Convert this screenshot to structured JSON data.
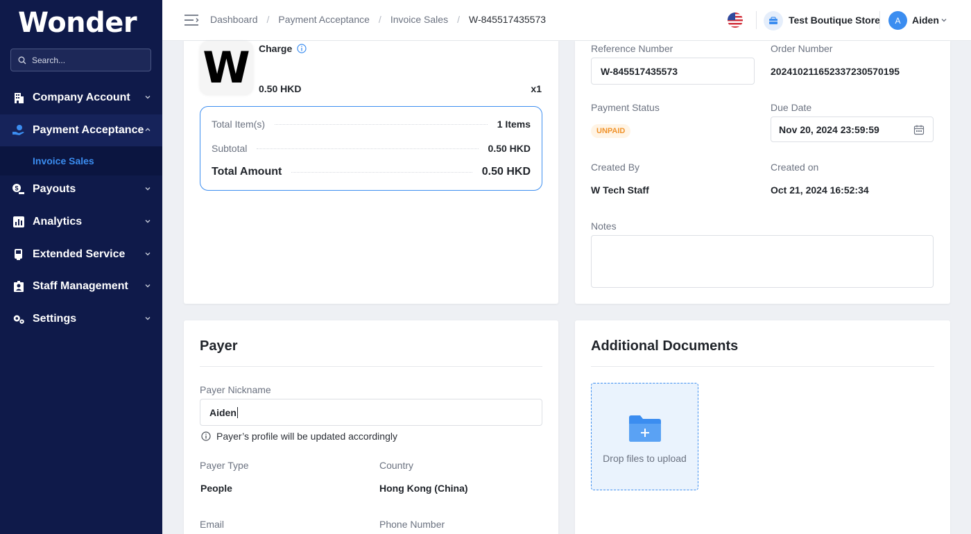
{
  "sidebar": {
    "brand": "Wonder",
    "search_placeholder": "Search...",
    "items": [
      {
        "label": "Company Account"
      },
      {
        "label": "Payment Acceptance"
      },
      {
        "label": "Payouts"
      },
      {
        "label": "Analytics"
      },
      {
        "label": "Extended Service"
      },
      {
        "label": "Staff Management"
      },
      {
        "label": "Settings"
      }
    ],
    "sub_item": "Invoice Sales"
  },
  "topbar": {
    "breadcrumbs": [
      "Dashboard",
      "Payment Acceptance",
      "Invoice Sales",
      "W-845517435573"
    ],
    "store": "Test Boutique Store",
    "avatar_initial": "A",
    "user": "Aiden"
  },
  "order": {
    "logo_letter": "W",
    "item_name": "Charge",
    "item_price": "0.50 HKD",
    "item_qty": "x1",
    "summary": {
      "total_items_label": "Total Item(s)",
      "total_items_value": "1 Items",
      "subtotal_label": "Subtotal",
      "subtotal_value": "0.50 HKD",
      "total_label": "Total Amount",
      "total_value": "0.50 HKD"
    }
  },
  "details": {
    "reference_label": "Reference Number",
    "reference_value": "W-845517435573",
    "order_label": "Order Number",
    "order_value": "20241021165233723057019​5",
    "status_label": "Payment Status",
    "status_value": "UNPAID",
    "due_label": "Due Date",
    "due_value": "Nov 20, 2024 23:59:59",
    "created_by_label": "Created By",
    "created_by_value": "W Tech Staff",
    "created_on_label": "Created on",
    "created_on_value": "Oct 21, 2024 16:52:34",
    "notes_label": "Notes",
    "notes_value": ""
  },
  "payer": {
    "title": "Payer",
    "nickname_label": "Payer Nickname",
    "nickname_value": "Aiden",
    "hint": "Payer’s profile will be updated accordingly",
    "type_label": "Payer Type",
    "type_value": "People",
    "country_label": "Country",
    "country_value": "Hong Kong (China)",
    "email_label": "Email",
    "phone_label": "Phone Number"
  },
  "documents": {
    "title": "Additional Documents",
    "drop_text": "Drop files to upload"
  },
  "colors": {
    "sidebar_bg": "#0f1a4a",
    "accent": "#3b8df0",
    "status_unpaid": "#f0932b"
  }
}
